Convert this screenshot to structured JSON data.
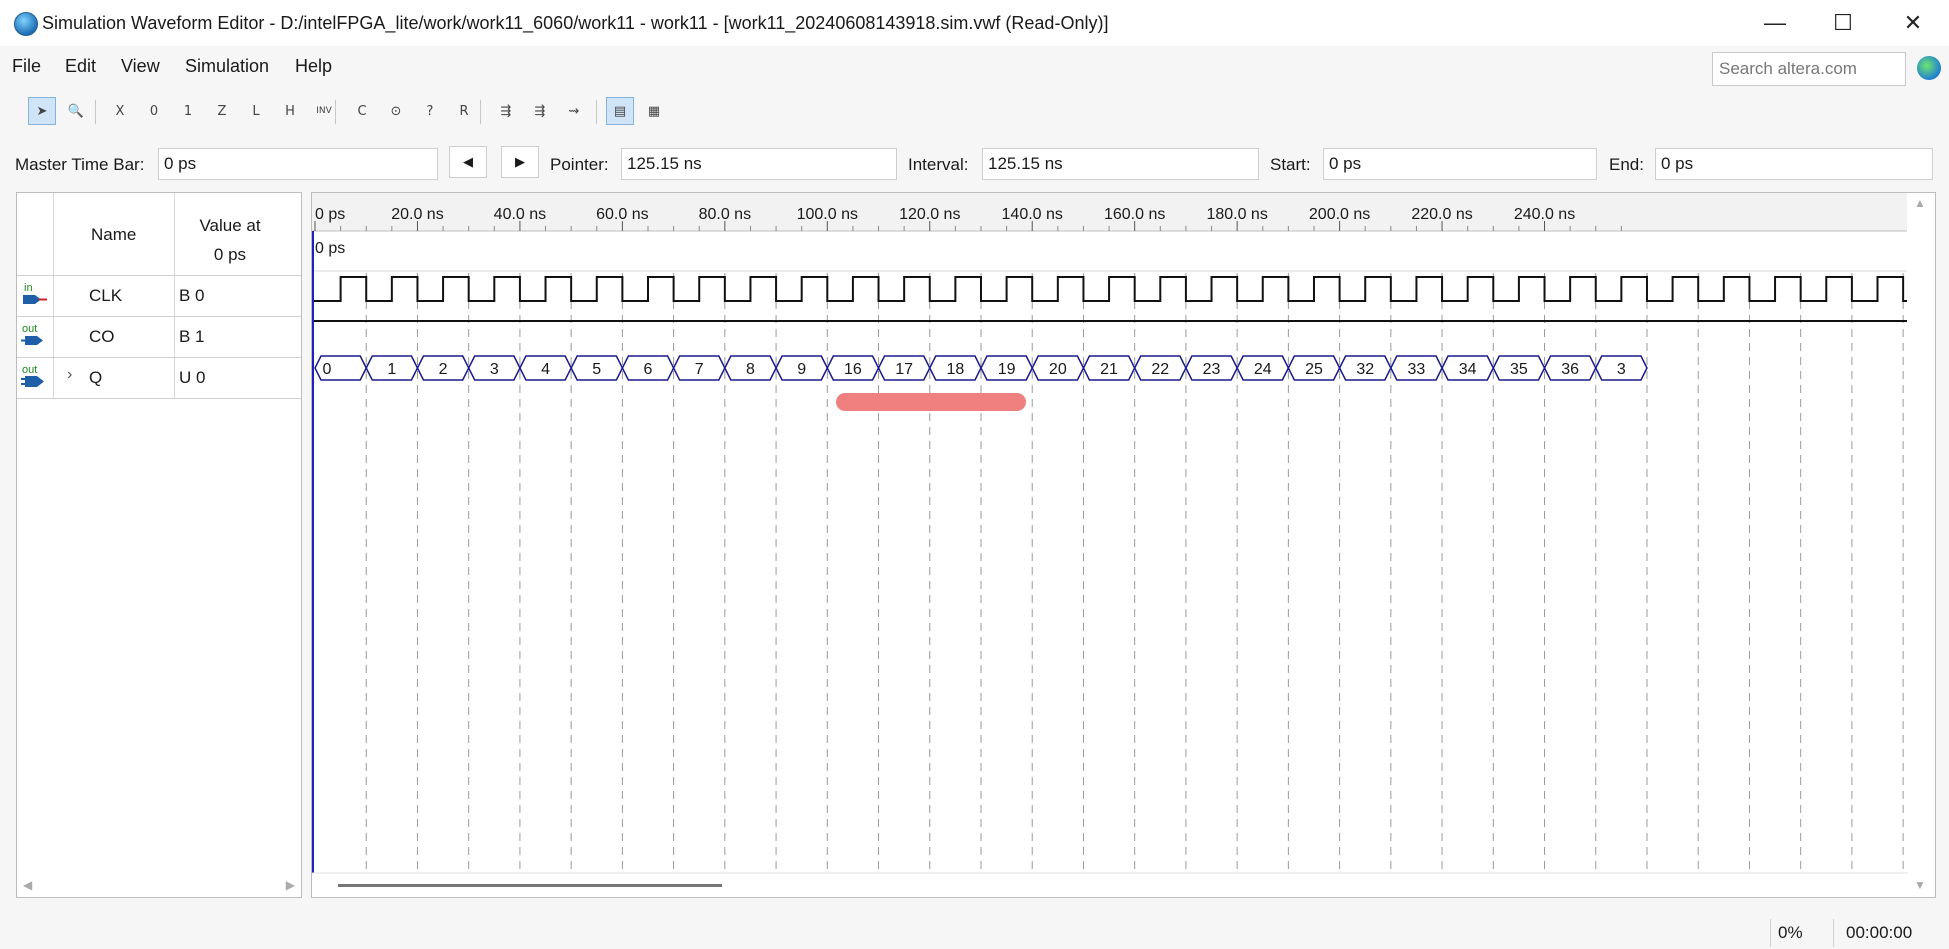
{
  "window": {
    "title": "Simulation Waveform Editor - D:/intelFPGA_lite/work/work11_6060/work11 - work11 - [work11_20240608143918.sim.vwf (Read-Only)]",
    "minimize": "—",
    "maximize": "☐",
    "close": "✕"
  },
  "menu": [
    "File",
    "Edit",
    "View",
    "Simulation",
    "Help"
  ],
  "search": {
    "placeholder": "Search altera.com"
  },
  "toolbar": {
    "tools": [
      {
        "name": "selection-tool-icon",
        "glyph": "➤",
        "active": true
      },
      {
        "name": "zoom-tool-icon",
        "glyph": "🔍",
        "active": false
      },
      {
        "name": "forcing-unknown-icon",
        "glyph": "X",
        "active": false
      },
      {
        "name": "forcing-low-icon",
        "glyph": "0",
        "active": false
      },
      {
        "name": "forcing-high-icon",
        "glyph": "1",
        "active": false
      },
      {
        "name": "high-impedance-icon",
        "glyph": "Z",
        "active": false
      },
      {
        "name": "weak-low-icon",
        "glyph": "L",
        "active": false
      },
      {
        "name": "weak-high-icon",
        "glyph": "H",
        "active": false
      },
      {
        "name": "invert-icon",
        "glyph": "INV",
        "active": false
      },
      {
        "name": "count-value-icon",
        "glyph": "C",
        "active": false
      },
      {
        "name": "overwrite-clock-icon",
        "glyph": "⊙",
        "active": false
      },
      {
        "name": "arbitrary-value-icon",
        "glyph": "?",
        "active": false
      },
      {
        "name": "random-values-icon",
        "glyph": "R",
        "active": false
      },
      {
        "name": "functional-simulation-icon",
        "glyph": "⇶",
        "active": false
      },
      {
        "name": "timing-simulation-icon",
        "glyph": "⇶",
        "active": false
      },
      {
        "name": "timing-netlist-icon",
        "glyph": "⇝",
        "active": false
      },
      {
        "name": "snap-to-grid-icon",
        "glyph": "▤",
        "active": true
      },
      {
        "name": "grid-settings-icon",
        "glyph": "▦",
        "active": false
      }
    ]
  },
  "timebar": {
    "master_label": "Master Time Bar:",
    "master_value": "0 ps",
    "pointer_label": "Pointer:",
    "pointer_value": "125.15 ns",
    "interval_label": "Interval:",
    "interval_value": "125.15 ns",
    "start_label": "Start:",
    "start_value": "0 ps",
    "end_label": "End:",
    "end_value": "0 ps"
  },
  "signal_table": {
    "col_name": "Name",
    "col_value_line1": "Value at",
    "col_value_line2": "0 ps",
    "signals": [
      {
        "dir": "in",
        "name": "CLK",
        "value": "B 0",
        "expand": ""
      },
      {
        "dir": "out",
        "name": "CO",
        "value": "B 1",
        "expand": ""
      },
      {
        "dir": "out",
        "name": "Q",
        "value": "U 0",
        "expand": "›"
      }
    ]
  },
  "waveform": {
    "ruler_labels": [
      "0 ps",
      "20.0 ns",
      "40.0 ns",
      "60.0 ns",
      "80.0 ns",
      "100.0 ns",
      "120.0 ns",
      "140.0 ns",
      "160.0 ns",
      "180.0 ns",
      "200.0 ns",
      "220.0 ns",
      "240.0 ns"
    ],
    "master_marker_label": "0 ps",
    "q_values": [
      "0",
      "1",
      "2",
      "3",
      "4",
      "5",
      "6",
      "7",
      "8",
      "9",
      "16",
      "17",
      "18",
      "19",
      "20",
      "21",
      "22",
      "23",
      "24",
      "25",
      "32",
      "33",
      "34",
      "35",
      "36",
      "3"
    ],
    "highlight_color": "#f08080",
    "wave_color": "#1a1a8c"
  },
  "status": {
    "progress": "0%",
    "elapsed": "00:00:00"
  }
}
